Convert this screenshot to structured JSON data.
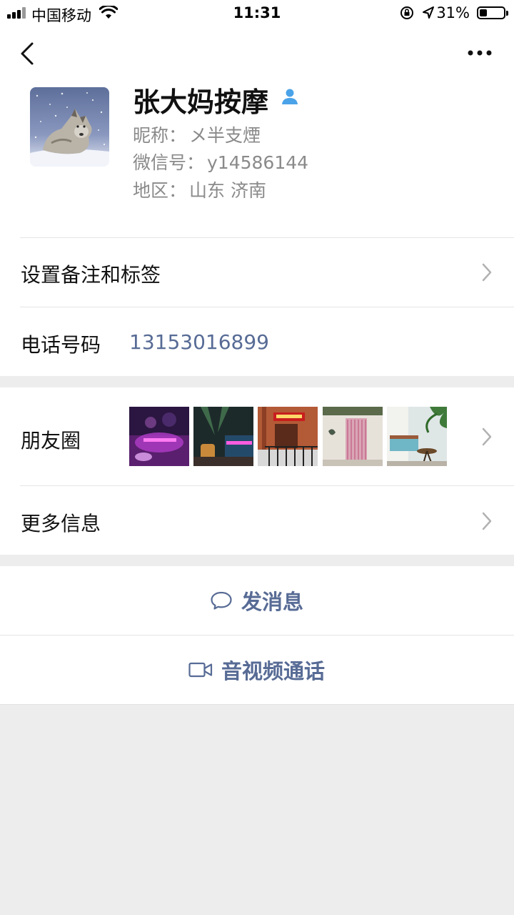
{
  "status_bar": {
    "carrier": "中国移动",
    "time": "11:31",
    "battery_percent": "31%",
    "battery_level": 0.31
  },
  "profile": {
    "name": "张大妈按摩",
    "nickname_label": "昵称：",
    "nickname": "メ半支煙",
    "wechat_id_label": "微信号：",
    "wechat_id": "y14586144",
    "region_label": "地区：",
    "region": "山东 济南"
  },
  "rows": {
    "remarks_tags": "设置备注和标签",
    "phone_label": "电话号码",
    "phone_value": "13153016899",
    "moments_label": "朋友圈",
    "more_info": "更多信息"
  },
  "actions": {
    "send_message": "发消息",
    "video_call": "音视频通话"
  },
  "colors": {
    "link_blue": "#576b95",
    "background": "#ededed",
    "verified_icon": "#4aa3e8"
  }
}
